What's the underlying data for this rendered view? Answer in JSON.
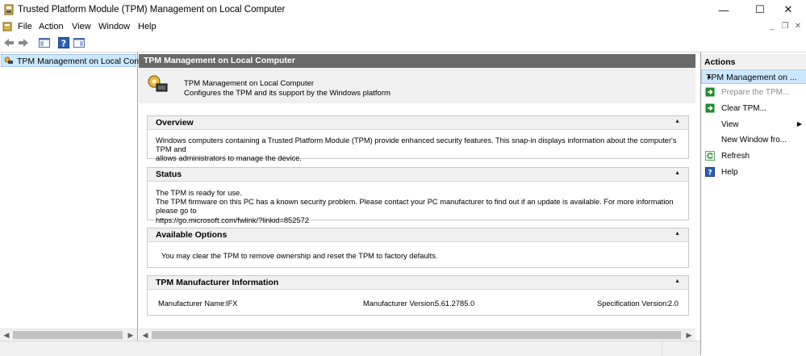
{
  "window": {
    "title": "Trusted Platform Module (TPM) Management on Local Computer",
    "minimize_glyph": "—",
    "maximize_glyph": "☐",
    "close_glyph": "✕"
  },
  "menu": {
    "items": [
      "File",
      "Action",
      "View",
      "Window",
      "Help"
    ],
    "mdi": {
      "minimize": "_",
      "restore": "❐",
      "close": "✕"
    }
  },
  "toolbar": {
    "buttons": [
      "back-arrow-icon",
      "forward-arrow-icon",
      "show-hide-console-tree-icon",
      "help-icon",
      "show-hide-action-pane-icon"
    ]
  },
  "tree": {
    "root_label": "TPM Management on Local Comp"
  },
  "center": {
    "header": "TPM Management on Local Computer",
    "intro_title": "TPM Management on Local Computer",
    "intro_desc": "Configures the TPM and its support by the Windows platform",
    "sections": {
      "overview": {
        "title": "Overview",
        "line1": "Windows computers containing a Trusted Platform Module (TPM) provide enhanced security features. This snap-in displays information about the computer's TPM and",
        "line2": "allows administrators to manage the device."
      },
      "status": {
        "title": "Status",
        "line1": "The TPM is ready for use.",
        "line2": "The TPM firmware on this PC has a known security problem. Please contact your PC manufacturer to find out if an update is available. For more information please go to",
        "line3": "https://go.microsoft.com/fwlink/?linkid=852572"
      },
      "options": {
        "title": "Available Options",
        "line1": "You may clear the TPM to remove ownership and reset the TPM to factory defaults."
      },
      "manufacturer": {
        "title": "TPM Manufacturer Information",
        "name_label": "Manufacturer Name:",
        "name_value": "IFX",
        "version_label": "Manufacturer Version:",
        "version_value": "5.61.2785.0",
        "spec_label": "Specification Version:",
        "spec_value": "2.0"
      }
    }
  },
  "actions": {
    "header": "Actions",
    "group": "TPM Management on ...",
    "items": [
      {
        "label": "Prepare the TPM...",
        "disabled": true
      },
      {
        "label": "Clear TPM...",
        "disabled": false
      },
      {
        "label": "View",
        "disabled": false
      },
      {
        "label": "New Window fro...",
        "disabled": false
      },
      {
        "label": "Refresh",
        "disabled": false
      },
      {
        "label": "Help",
        "disabled": false
      }
    ]
  },
  "colors": {
    "selection": "#cce8ff",
    "header_bar": "#696969",
    "panel_bg": "#f0f0f0",
    "action_green": "#1e8a2e",
    "help_blue": "#2a5fb8"
  }
}
